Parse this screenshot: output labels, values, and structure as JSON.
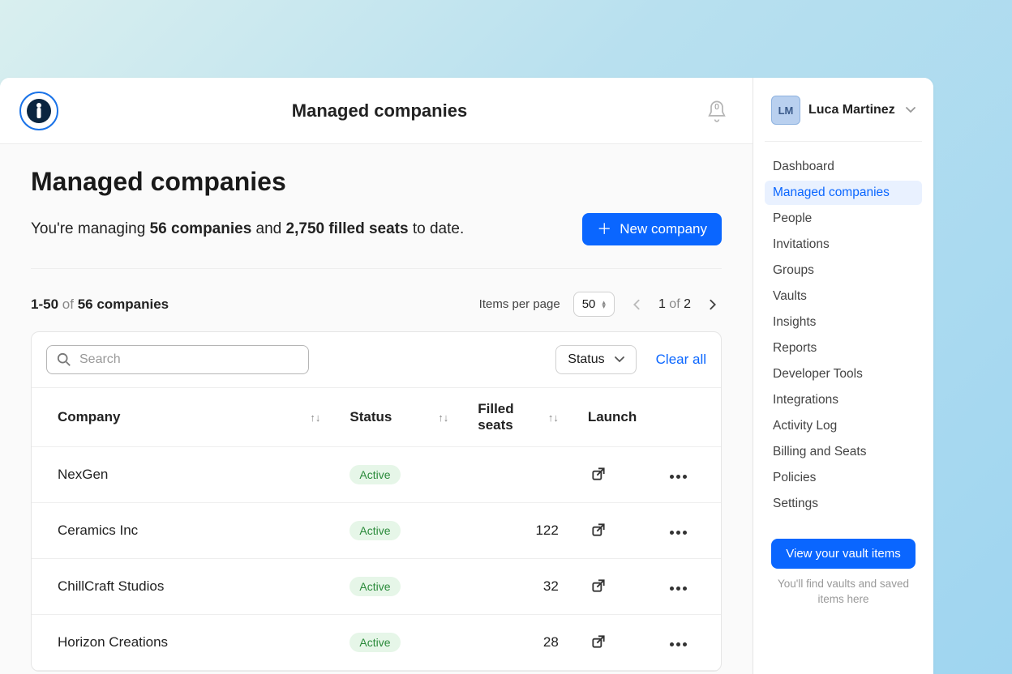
{
  "header": {
    "title": "Managed companies",
    "notif_count": "0"
  },
  "page": {
    "title": "Managed companies",
    "summary_prefix": "You're managing ",
    "summary_companies": "56 companies",
    "summary_and": " and ",
    "summary_seats": "2,750 filled seats",
    "summary_suffix": " to date.",
    "new_company_label": "New company"
  },
  "list_meta": {
    "range": "1-50",
    "of_label": "of",
    "total": "56 companies",
    "items_per_page_label": "Items per page",
    "items_per_page_value": "50",
    "page_current": "1",
    "page_of": "of",
    "page_total": "2"
  },
  "filters": {
    "search_placeholder": "Search",
    "status_label": "Status",
    "clear_all_label": "Clear all"
  },
  "columns": {
    "company": "Company",
    "status": "Status",
    "filled_seats": "Filled seats",
    "launch": "Launch"
  },
  "rows": [
    {
      "company": "NexGen",
      "status": "Active",
      "filled_seats": ""
    },
    {
      "company": "Ceramics Inc",
      "status": "Active",
      "filled_seats": "122"
    },
    {
      "company": "ChillCraft Studios",
      "status": "Active",
      "filled_seats": "32"
    },
    {
      "company": "Horizon Creations",
      "status": "Active",
      "filled_seats": "28"
    }
  ],
  "user": {
    "initials": "LM",
    "name": "Luca Martinez"
  },
  "nav": [
    "Dashboard",
    "Managed companies",
    "People",
    "Invitations",
    "Groups",
    "Vaults",
    "Insights",
    "Reports",
    "Developer Tools",
    "Integrations",
    "Activity Log",
    "Billing and Seats",
    "Policies",
    "Settings"
  ],
  "nav_active_index": 1,
  "vault": {
    "button": "View your vault items",
    "help": "You'll find vaults and saved items here"
  }
}
